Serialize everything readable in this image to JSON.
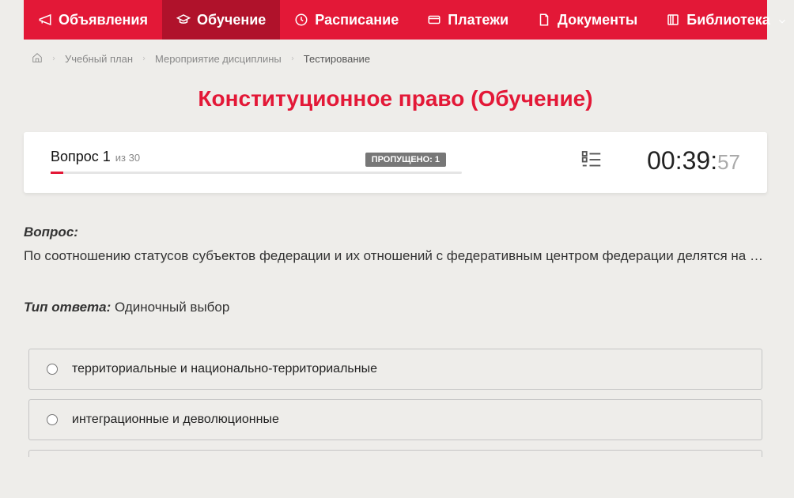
{
  "nav": {
    "items": [
      {
        "label": "Объявления",
        "icon": "megaphone-icon",
        "active": false,
        "hasDropdown": false
      },
      {
        "label": "Обучение",
        "icon": "education-icon",
        "active": true,
        "hasDropdown": false
      },
      {
        "label": "Расписание",
        "icon": "clock-icon",
        "active": false,
        "hasDropdown": false
      },
      {
        "label": "Платежи",
        "icon": "payment-icon",
        "active": false,
        "hasDropdown": false
      },
      {
        "label": "Документы",
        "icon": "document-icon",
        "active": false,
        "hasDropdown": false
      },
      {
        "label": "Библиотека",
        "icon": "library-icon",
        "active": false,
        "hasDropdown": true
      }
    ]
  },
  "breadcrumb": {
    "items": [
      {
        "label": "Учебный план"
      },
      {
        "label": "Мероприятие дисциплины"
      }
    ],
    "current": "Тестирование"
  },
  "page": {
    "title": "Конституционное право (Обучение)"
  },
  "status": {
    "question_label": "Вопрос 1",
    "question_of": "из 30",
    "skipped_label": "ПРОПУЩЕНО: 1",
    "timer_main": "00:39:",
    "timer_secs": "57",
    "progress_percent": 3
  },
  "question": {
    "heading": "Вопрос:",
    "text": "По соотношению статусов субъектов федерации и их отношений с федеративным центром федерации делятся на …",
    "answer_type_label": "Тип ответа:",
    "answer_type_value": "Одиночный выбор"
  },
  "answers": [
    {
      "text": "территориальные и национально-территориальные"
    },
    {
      "text": "интеграционные и деволюционные"
    }
  ]
}
